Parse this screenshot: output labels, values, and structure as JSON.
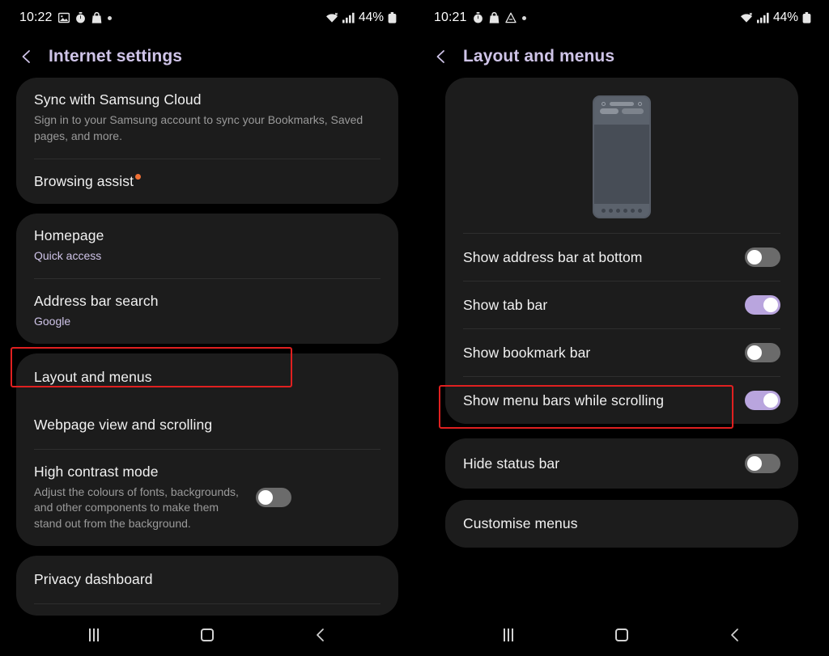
{
  "left_panel": {
    "status_bar": {
      "time": "10:22",
      "icons": [
        "gallery-icon",
        "stopwatch-icon",
        "shopping-bag-icon",
        "dot-icon"
      ],
      "battery_percent": "44%",
      "right_icons": [
        "wifi-icon",
        "signal-icon",
        "battery-icon"
      ]
    },
    "title": "Internet settings",
    "back_label": "Back",
    "cards": [
      {
        "rows": [
          {
            "title": "Sync with Samsung Cloud",
            "subtitle": "Sign in to your Samsung account to sync your Bookmarks, Saved pages, and more.",
            "subtitle_accent": false,
            "badge": false,
            "toggle": null
          },
          {
            "title": "Browsing assist",
            "subtitle": "",
            "subtitle_accent": false,
            "badge": true,
            "toggle": null
          }
        ]
      },
      {
        "rows": [
          {
            "title": "Homepage",
            "subtitle": "Quick access",
            "subtitle_accent": true,
            "badge": false,
            "toggle": null
          },
          {
            "title": "Address bar search",
            "subtitle": "Google",
            "subtitle_accent": true,
            "badge": false,
            "toggle": null
          }
        ]
      },
      {
        "rows": [
          {
            "title": "Layout and menus",
            "subtitle": "",
            "subtitle_accent": false,
            "badge": false,
            "toggle": null
          },
          {
            "title": "Webpage view and scrolling",
            "subtitle": "",
            "subtitle_accent": false,
            "badge": false,
            "toggle": null
          },
          {
            "title": "High contrast mode",
            "subtitle": "Adjust the colours of fonts, backgrounds, and other components to make them stand out from the background.",
            "subtitle_accent": false,
            "badge": false,
            "toggle": "off"
          }
        ]
      },
      {
        "rows": [
          {
            "title": "Privacy dashboard",
            "subtitle": "",
            "subtitle_accent": false,
            "badge": false,
            "toggle": null
          }
        ]
      }
    ],
    "highlight": {
      "target": "Layout and menus",
      "color": "#e02020"
    },
    "nav": {
      "recents": "recents-button",
      "home": "home-button",
      "back": "back-button"
    }
  },
  "right_panel": {
    "status_bar": {
      "time": "10:21",
      "icons": [
        "stopwatch-icon",
        "shopping-bag-icon",
        "drive-icon",
        "dot-icon"
      ],
      "battery_percent": "44%",
      "right_icons": [
        "wifi-icon",
        "signal-icon",
        "battery-icon"
      ]
    },
    "title": "Layout and menus",
    "back_label": "Back",
    "preview": {
      "name": "phone-layout-preview"
    },
    "cards": [
      {
        "has_preview": true,
        "rows": [
          {
            "title": "Show address bar at bottom",
            "subtitle": "",
            "subtitle_accent": false,
            "badge": false,
            "toggle": "off"
          },
          {
            "title": "Show tab bar",
            "subtitle": "",
            "subtitle_accent": false,
            "badge": false,
            "toggle": "on"
          },
          {
            "title": "Show bookmark bar",
            "subtitle": "",
            "subtitle_accent": false,
            "badge": false,
            "toggle": "off"
          },
          {
            "title": "Show menu bars while scrolling",
            "subtitle": "",
            "subtitle_accent": false,
            "badge": false,
            "toggle": "on"
          }
        ]
      },
      {
        "has_preview": false,
        "rows": [
          {
            "title": "Hide status bar",
            "subtitle": "",
            "subtitle_accent": false,
            "badge": false,
            "toggle": "off"
          }
        ]
      },
      {
        "has_preview": false,
        "rows": [
          {
            "title": "Customise menus",
            "subtitle": "",
            "subtitle_accent": false,
            "badge": false,
            "toggle": null
          }
        ]
      }
    ],
    "highlight": {
      "target": "Show menu bars while scrolling",
      "color": "#e02020"
    },
    "nav": {
      "recents": "recents-button",
      "home": "home-button",
      "back": "back-button"
    }
  },
  "colors": {
    "background": "#000000",
    "card": "#1c1c1c",
    "title_accent": "#cfc4e8",
    "toggle_on": "#b9a5de",
    "toggle_off": "#6b6b6b",
    "badge": "#ef7035",
    "highlight": "#e02020"
  }
}
